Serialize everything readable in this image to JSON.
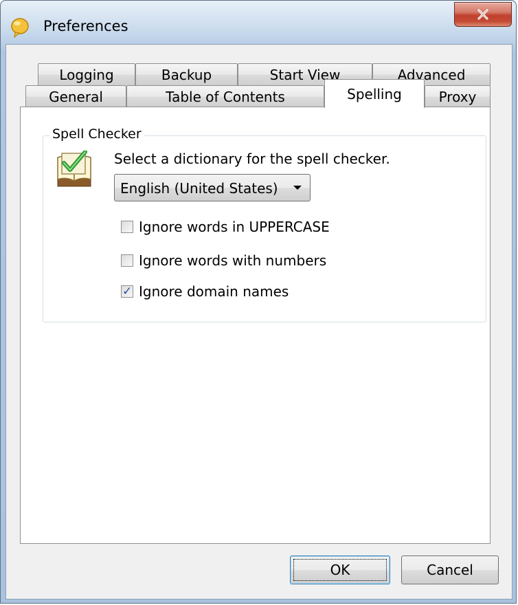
{
  "window": {
    "title": "Preferences",
    "close_icon": "close-x-icon",
    "app_icon": "yellow-speech-icon"
  },
  "tabs": {
    "row_top": [
      "Logging",
      "Backup",
      "Start View",
      "Advanced"
    ],
    "row_bottom": [
      "General",
      "Table of Contents",
      "Spelling",
      "Proxy"
    ],
    "selected": "Spelling"
  },
  "spell_checker": {
    "group_label": "Spell Checker",
    "prompt": "Select a dictionary for the spell checker.",
    "dictionary": "English (United States)",
    "options": [
      {
        "label": "Ignore words in UPPERCASE",
        "checked": false
      },
      {
        "label": "Ignore words with numbers",
        "checked": false
      },
      {
        "label": "Ignore domain names",
        "checked": true
      }
    ]
  },
  "buttons": {
    "ok": "OK",
    "cancel": "Cancel"
  },
  "colors": {
    "accent": "#2b4f9b",
    "close_red": "#c0402c",
    "frame": "#b8cfe7"
  }
}
